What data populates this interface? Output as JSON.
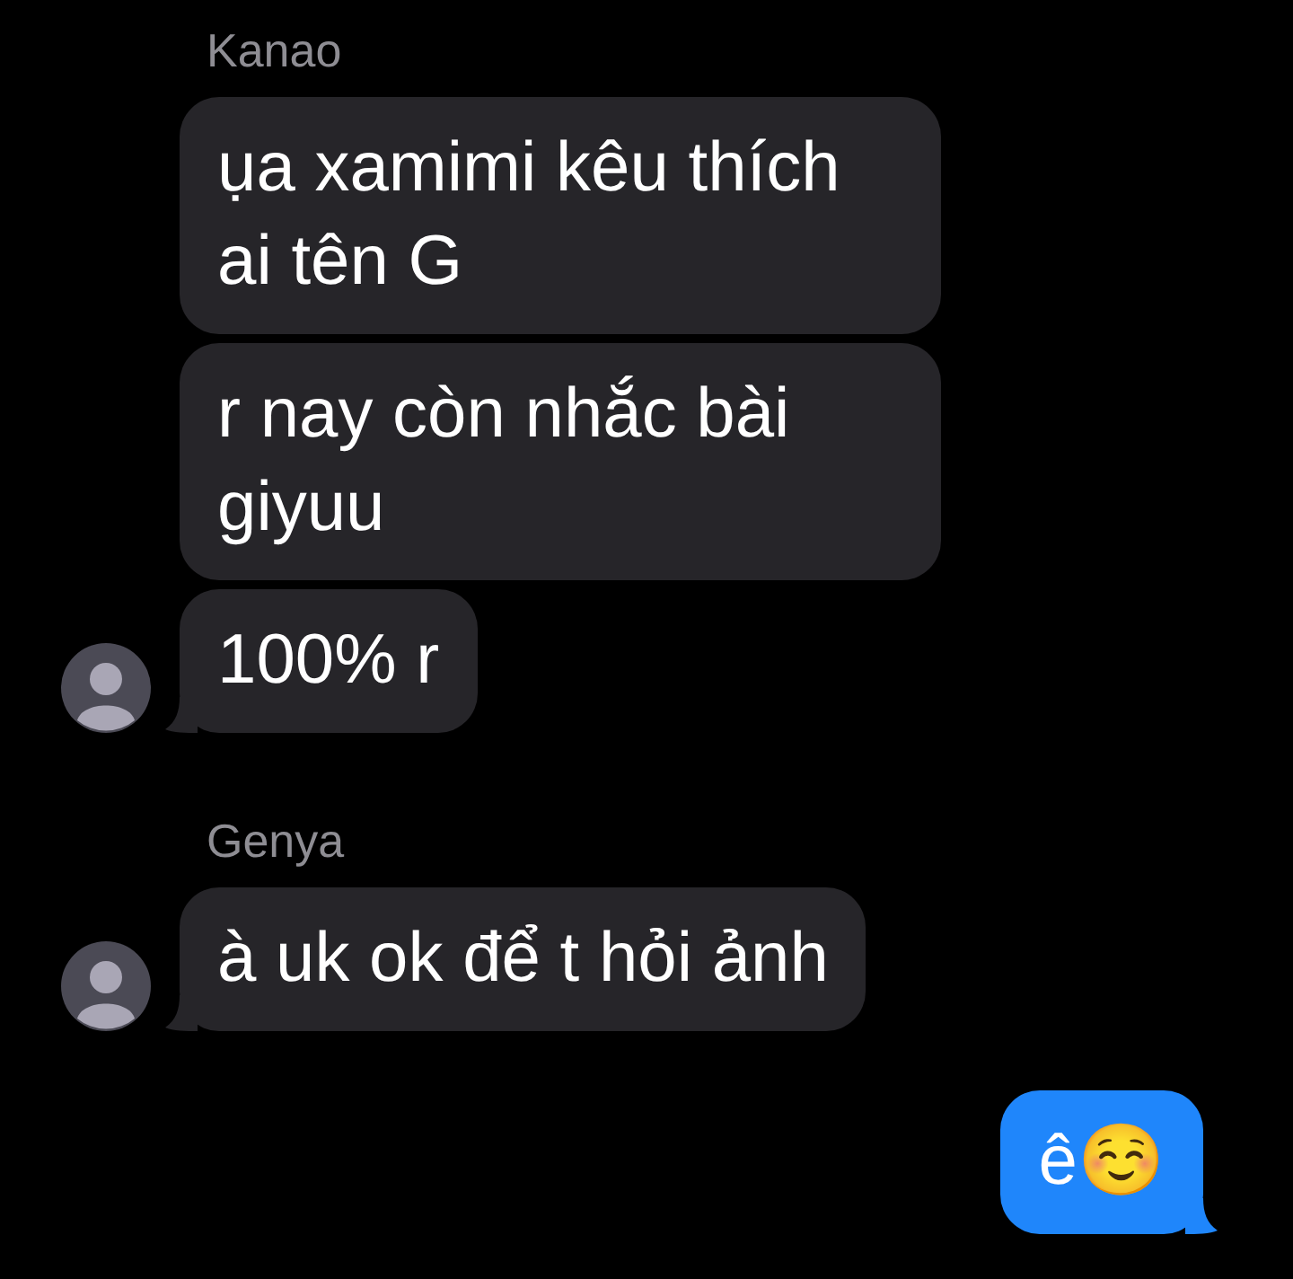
{
  "groups": [
    {
      "kind": "incoming",
      "sender": "Kanao",
      "messages": [
        "ụa xamimi kêu thích ai tên G",
        "r nay còn nhắc bài giyuu",
        "100% r"
      ]
    },
    {
      "kind": "incoming",
      "sender": "Genya",
      "messages": [
        "à uk ok để t hỏi ảnh"
      ]
    },
    {
      "kind": "outgoing",
      "messages": [
        "ê☺️"
      ]
    }
  ]
}
